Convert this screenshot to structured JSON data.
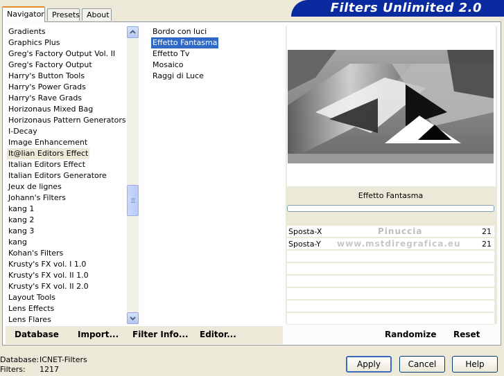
{
  "tabs": [
    {
      "label": "Navigator"
    },
    {
      "label": "Presets"
    },
    {
      "label": "About"
    }
  ],
  "banner_title": "Filters Unlimited 2.0",
  "categories": [
    "Gradients",
    "Graphics Plus",
    "Greg's Factory Output Vol. II",
    "Greg's Factory Output",
    "Harry's Button Tools",
    "Harry's Power Grads",
    "Harry's Rave Grads",
    "Horizonaus Mixed Bag",
    "Horizonaus Pattern Generators",
    "I-Decay",
    "Image Enhancement",
    "It@lian Editors Effect",
    "Italian Editors Effect",
    "Italian Editors Generatore",
    "Jeux de lignes",
    "Johann's Filters",
    "kang 1",
    "kang 2",
    "kang 3",
    "kang",
    "Kohan's Filters",
    "Krusty's FX vol. I 1.0",
    "Krusty's FX vol. II 1.0",
    "Krusty's FX vol. II 2.0",
    "Layout Tools",
    "Lens Effects",
    "Lens Flares"
  ],
  "selected_category_index": 11,
  "filters": [
    "Bordo con luci",
    "Effetto Fantasma",
    "Effetto Tv",
    "Mosaico",
    "Raggi di Luce"
  ],
  "selected_filter_index": 1,
  "filter_name": "Effetto Fantasma",
  "watermark": {
    "line1": "Pinuccia",
    "line2": "www.mstdiregrafica.eu"
  },
  "params": [
    {
      "label": "Sposta-X",
      "value": "21"
    },
    {
      "label": "Sposta-Y",
      "value": "21"
    }
  ],
  "links": {
    "database": "Database",
    "import": "Import...",
    "filter_info": "Filter Info...",
    "editor": "Editor...",
    "randomize": "Randomize",
    "reset": "Reset"
  },
  "buttons": {
    "apply": "Apply",
    "cancel": "Cancel",
    "help": "Help"
  },
  "status": {
    "database_label": "Database:",
    "database_value": "ICNET-Filters",
    "filters_label": "Filters:",
    "filters_value": "1217"
  },
  "colors": {
    "banner": "#0a2aa0",
    "selection": "#316ac5",
    "tab_accent": "#e68b2c"
  }
}
